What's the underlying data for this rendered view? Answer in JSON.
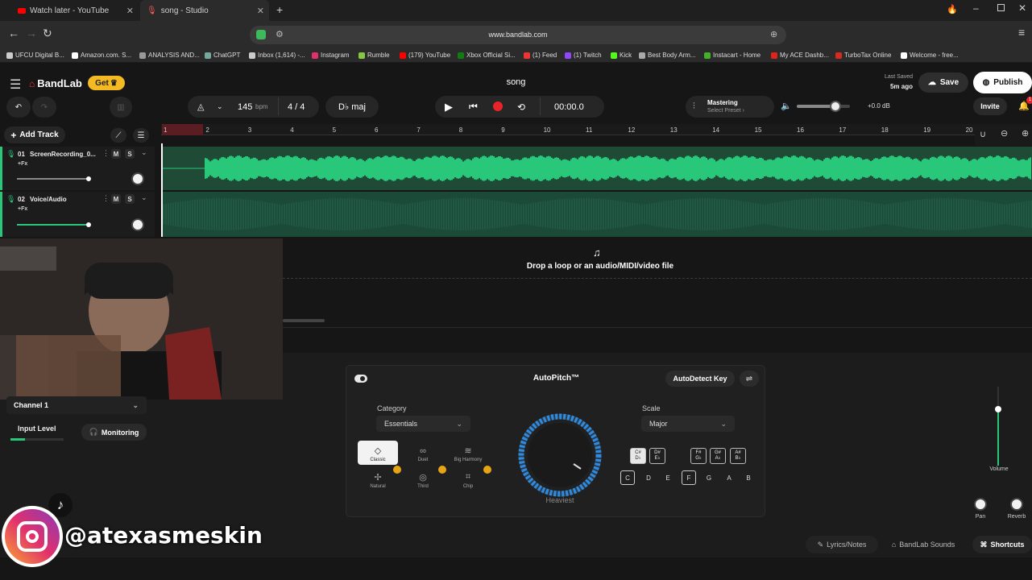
{
  "browser": {
    "tabs": [
      {
        "title": "Watch later - YouTube",
        "icon_color": "#ff0000"
      },
      {
        "title": "song - Studio",
        "icon_color": "#ff3b3b"
      }
    ],
    "url": "www.bandlab.com",
    "bookmarks": [
      {
        "label": "UFCU Digital B...",
        "icon_color": "#cccccc"
      },
      {
        "label": "Amazon.com. S...",
        "icon_color": "#ffffff"
      },
      {
        "label": "ANALYSIS AND...",
        "icon_color": "#999999"
      },
      {
        "label": "ChatGPT",
        "icon_color": "#74aa9c"
      },
      {
        "label": "Inbox (1,614) -...",
        "icon_color": "#cccccc"
      },
      {
        "label": "Instagram",
        "icon_color": "#e1306c"
      },
      {
        "label": "Rumble",
        "icon_color": "#85c742"
      },
      {
        "label": "(179) YouTube",
        "icon_color": "#ff0000"
      },
      {
        "label": "Xbox Official Si...",
        "icon_color": "#107c10"
      },
      {
        "label": "(1) Feed",
        "icon_color": "#e33"
      },
      {
        "label": "(1) Twitch",
        "icon_color": "#9146ff"
      },
      {
        "label": "Kick",
        "icon_color": "#53fc18"
      },
      {
        "label": "Best Body Arm...",
        "icon_color": "#aaaaaa"
      },
      {
        "label": "Instacart - Home",
        "icon_color": "#43b02a"
      },
      {
        "label": "My ACE Dashb...",
        "icon_color": "#e2231a"
      },
      {
        "label": "TurboTax Online",
        "icon_color": "#d52b1e"
      },
      {
        "label": "Welcome - free...",
        "icon_color": "#ffffff"
      }
    ]
  },
  "app": {
    "brand": "BandLab",
    "get_label": "Get",
    "project_title": "song",
    "last_saved_label": "Last Saved",
    "last_saved_time": "5m ago",
    "save_label": "Save",
    "publish_label": "Publish",
    "invite_label": "Invite",
    "notification_count": "1",
    "accent_color": "#f5b921",
    "wave_color": "#28c77a"
  },
  "transport": {
    "bpm": "145",
    "bpm_unit": "bpm",
    "time_signature": "4 / 4",
    "key": "D♭ maj",
    "time": "00:00.0",
    "mastering_label": "Mastering",
    "mastering_preset": "Select Preset ›",
    "volume_db": "+0.0 dB",
    "volume_level": 0.72
  },
  "timeline": {
    "add_track_label": "Add Track",
    "bars": [
      "1",
      "2",
      "3",
      "4",
      "5",
      "6",
      "7",
      "8",
      "9",
      "10",
      "11",
      "12",
      "13",
      "14",
      "15",
      "16",
      "17",
      "18",
      "19",
      "20"
    ]
  },
  "tracks": [
    {
      "number": "01",
      "name": "ScreenRecording_0...",
      "fx": "+Fx",
      "mute": "M",
      "solo": "S"
    },
    {
      "number": "02",
      "name": "Voice/Audio",
      "fx": "+Fx",
      "mute": "M",
      "solo": "S"
    }
  ],
  "dropzone": {
    "text": "Drop a loop or an audio/MIDI/video file"
  },
  "input_panel": {
    "channel": "Channel 1",
    "input_level_label": "Input Level",
    "monitoring_label": "Monitoring"
  },
  "autopitch": {
    "title": "AutoPitch™",
    "autodetect_label": "AutoDetect Key",
    "category_label": "Category",
    "category_value": "Essentials",
    "categories": [
      {
        "label": "Classic",
        "selected": true
      },
      {
        "label": "Duet"
      },
      {
        "label": "Big Harmony"
      },
      {
        "label": "Natural"
      },
      {
        "label": "Third"
      },
      {
        "label": "Chip"
      }
    ],
    "dial_label": "Heaviest",
    "scale_label": "Scale",
    "scale_value": "Major",
    "sharp_keys": [
      {
        "top": "C#",
        "bottom": "D♭"
      },
      {
        "top": "D#",
        "bottom": "E♭"
      },
      {
        "top": "F#",
        "bottom": "G♭"
      },
      {
        "top": "G#",
        "bottom": "A♭"
      },
      {
        "top": "A#",
        "bottom": "B♭"
      }
    ],
    "natural_keys": [
      "C",
      "D",
      "E",
      "F",
      "G",
      "A",
      "B"
    ]
  },
  "mixer": {
    "volume_label": "Volume",
    "pan_label": "Pan",
    "reverb_label": "Reverb"
  },
  "footer": {
    "lyrics_label": "Lyrics/Notes",
    "sounds_label": "BandLab Sounds",
    "shortcuts_label": "Shortcuts"
  },
  "overlay": {
    "handle": "@atexasmeskin"
  }
}
